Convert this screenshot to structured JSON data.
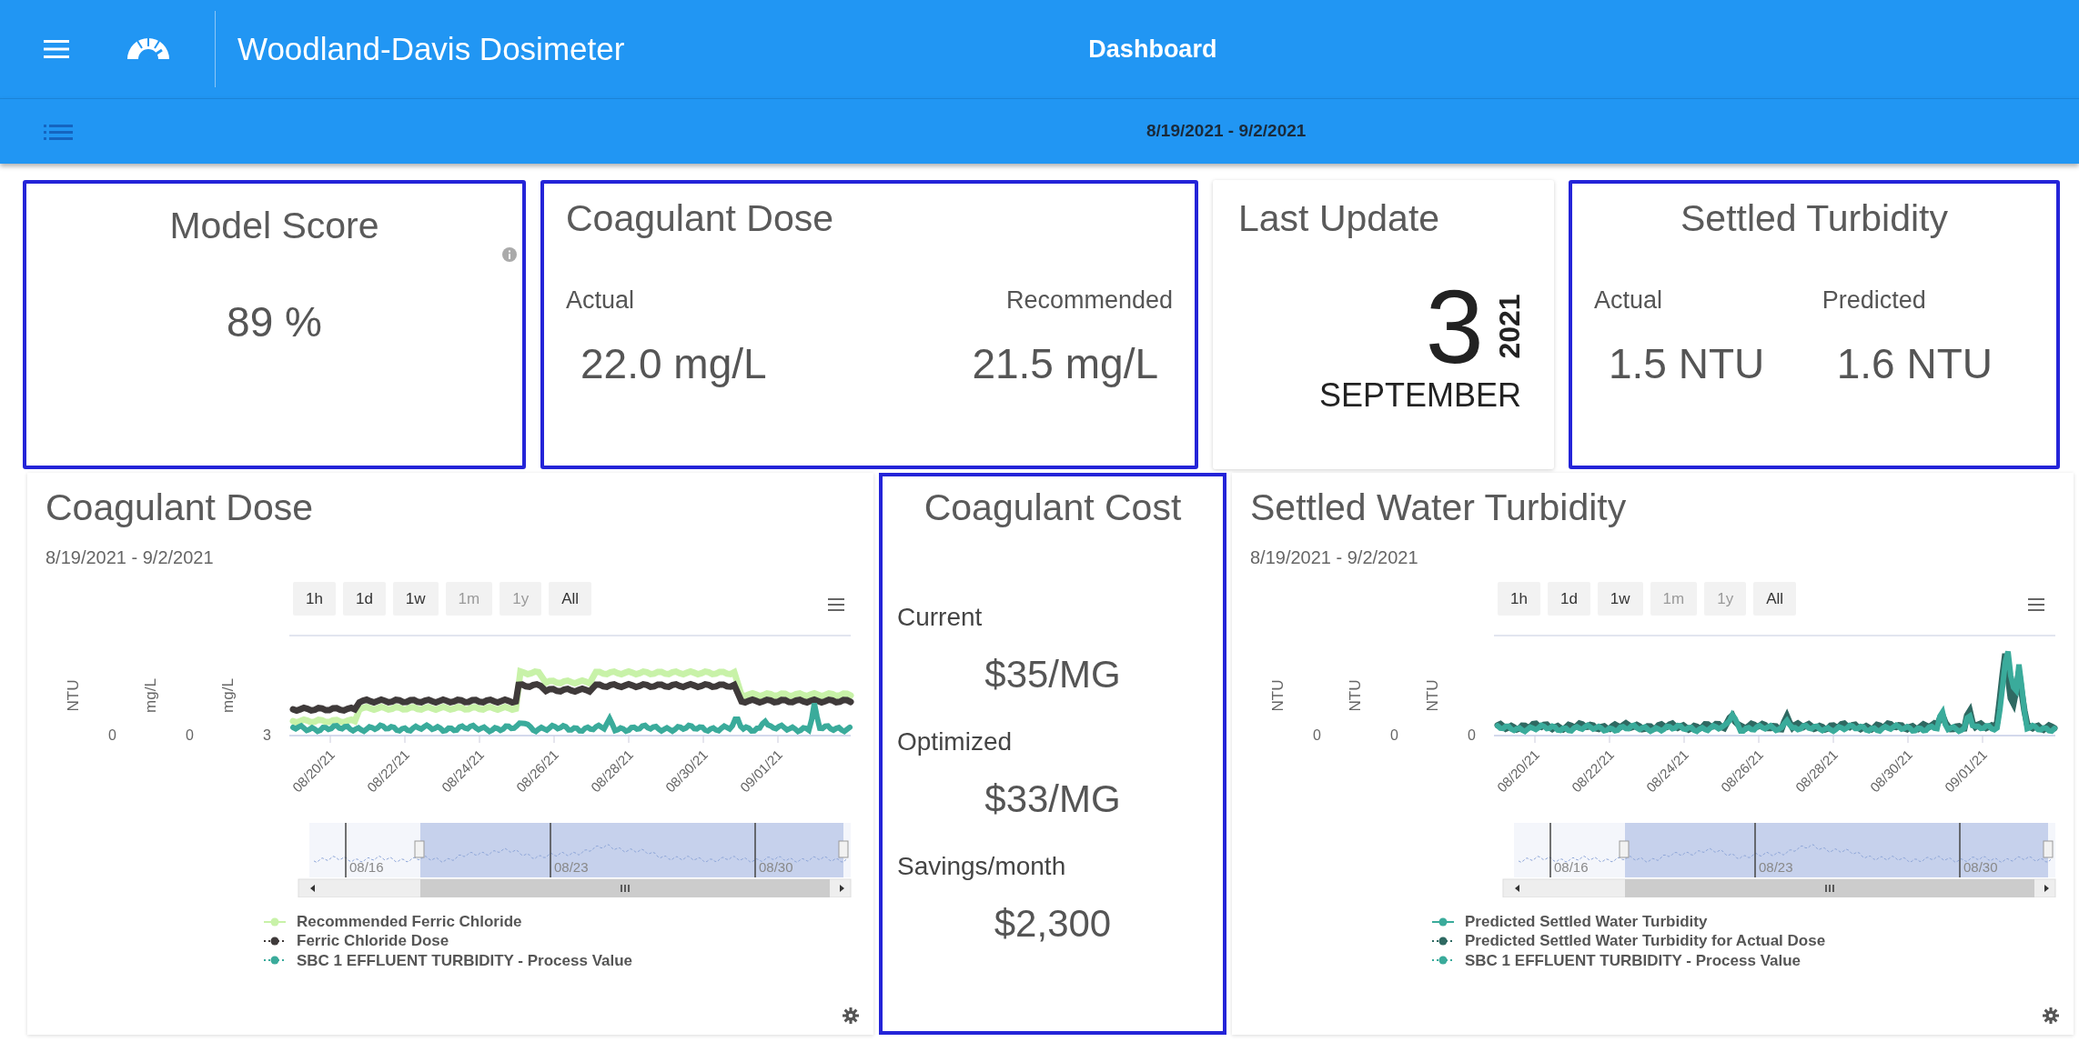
{
  "app_bar": {
    "title": "Woodland-Davis Dosimeter",
    "page_title": "Dashboard"
  },
  "toolbar": {
    "date_range": "8/19/2021 - 9/2/2021"
  },
  "summary_cards": [
    {
      "kind": "score",
      "title": "Model Score",
      "value": "89 %",
      "highlighted": true
    },
    {
      "kind": "pair",
      "title": "Coagulant Dose",
      "metrics": [
        {
          "label": "Actual",
          "value": "22.0 mg/L"
        },
        {
          "label": "Recommended",
          "value": "21.5 mg/L"
        }
      ],
      "highlighted": true
    },
    {
      "kind": "date",
      "title": "Last Update",
      "day": "3",
      "year": "2021",
      "month": "SEPTEMBER",
      "highlighted": false
    },
    {
      "kind": "pair",
      "title": "Settled Turbidity",
      "metrics": [
        {
          "label": "Actual",
          "value": "1.5 NTU"
        },
        {
          "label": "Predicted",
          "value": "1.6 NTU"
        }
      ],
      "highlighted": true
    }
  ],
  "panels": [
    {
      "kind": "chart",
      "title": "Coagulant Dose",
      "date_range": "8/19/2021 - 9/2/2021",
      "highlighted": false,
      "range_buttons": [
        {
          "label": "1h",
          "disabled": false
        },
        {
          "label": "1d",
          "disabled": false
        },
        {
          "label": "1w",
          "disabled": false
        },
        {
          "label": "1m",
          "disabled": true
        },
        {
          "label": "1y",
          "disabled": true
        },
        {
          "label": "All",
          "disabled": false
        }
      ],
      "y_axes": [
        {
          "label": "NTU",
          "tick": "0"
        },
        {
          "label": "mg/L",
          "tick": "0"
        },
        {
          "label": "mg/L",
          "tick": "3"
        }
      ],
      "x_ticks": [
        "08/20/21",
        "08/22/21",
        "08/24/21",
        "08/26/21",
        "08/28/21",
        "08/30/21",
        "09/01/21"
      ],
      "navigator_labels": [
        "08/16",
        "08/23",
        "08/30"
      ],
      "legend": [
        {
          "label": "Recommended Ferric Chloride",
          "color": "#c8f2a8"
        },
        {
          "label": "Ferric Chloride Dose",
          "color": "#3f3a3a"
        },
        {
          "label": "SBC 1 EFFLUENT TURBIDITY - Process Value",
          "color": "#3aab9b"
        }
      ]
    },
    {
      "kind": "cost",
      "title": "Coagulant Cost",
      "highlighted": true,
      "items": [
        {
          "label": "Current",
          "value": "$35/MG"
        },
        {
          "label": "Optimized",
          "value": "$33/MG"
        },
        {
          "label": "Savings/month",
          "value": "$2,300"
        }
      ]
    },
    {
      "kind": "chart",
      "title": "Settled Water Turbidity",
      "date_range": "8/19/2021 - 9/2/2021",
      "highlighted": false,
      "range_buttons": [
        {
          "label": "1h",
          "disabled": false
        },
        {
          "label": "1d",
          "disabled": false
        },
        {
          "label": "1w",
          "disabled": false
        },
        {
          "label": "1m",
          "disabled": true
        },
        {
          "label": "1y",
          "disabled": true
        },
        {
          "label": "All",
          "disabled": false
        }
      ],
      "y_axes": [
        {
          "label": "NTU",
          "tick": "0"
        },
        {
          "label": "NTU",
          "tick": "0"
        },
        {
          "label": "NTU",
          "tick": "0"
        }
      ],
      "x_ticks": [
        "08/20/21",
        "08/22/21",
        "08/24/21",
        "08/26/21",
        "08/28/21",
        "08/30/21",
        "09/01/21"
      ],
      "navigator_labels": [
        "08/16",
        "08/23",
        "08/30"
      ],
      "legend": [
        {
          "label": "Predicted Settled Water Turbidity",
          "color": "#3aab9b"
        },
        {
          "label": "Predicted Settled Water Turbidity for Actual Dose",
          "color": "#2f6962"
        },
        {
          "label": "SBC 1 EFFLUENT TURBIDITY - Process Value",
          "color": "#3aab9b"
        }
      ]
    }
  ]
}
